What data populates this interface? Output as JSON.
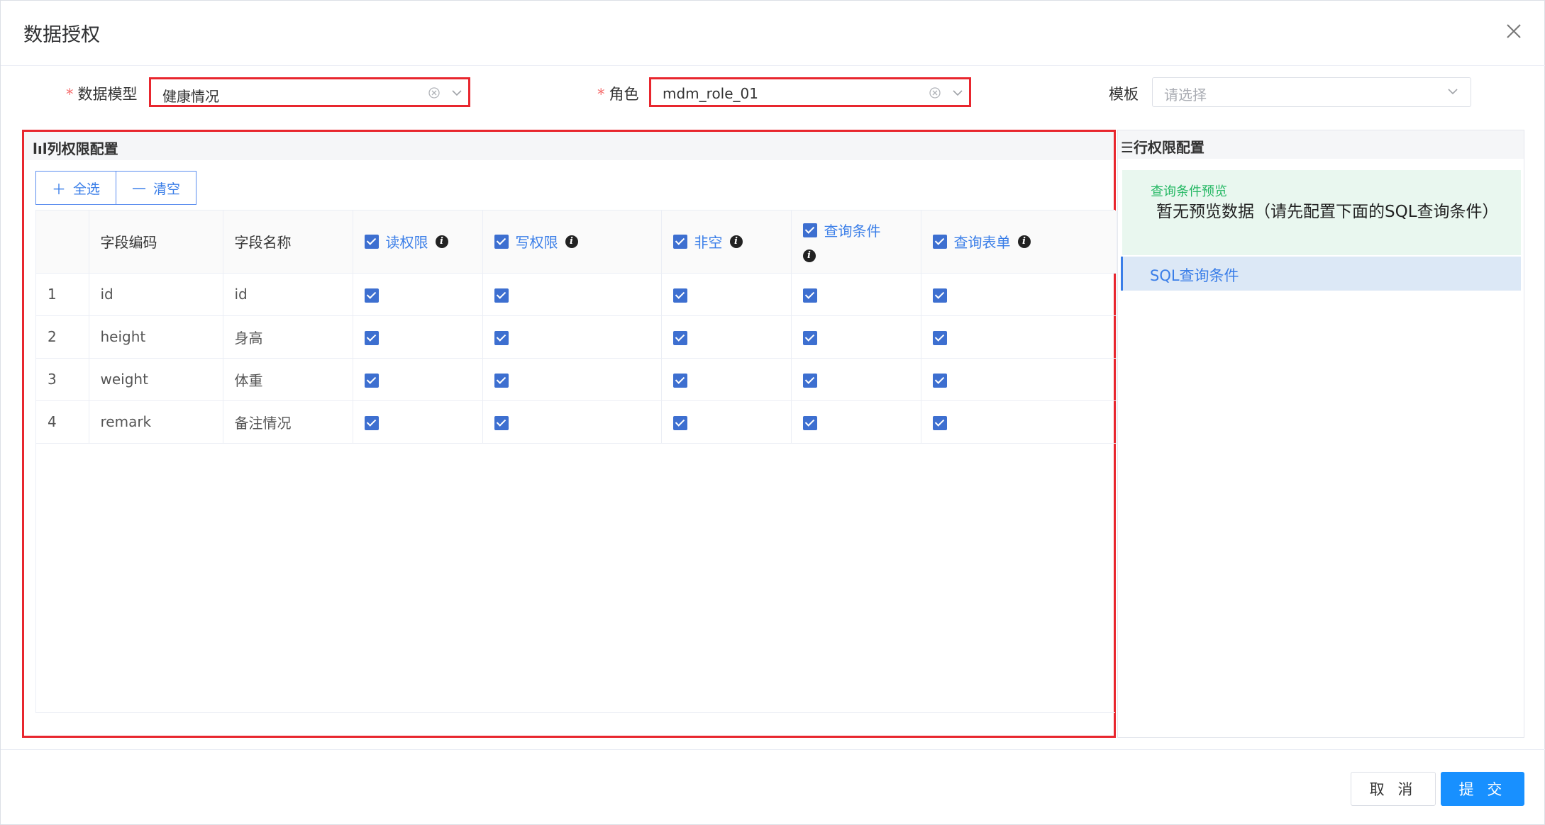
{
  "dialog": {
    "title": "数据授权"
  },
  "form": {
    "model": {
      "label": "数据模型",
      "value": "健康情况"
    },
    "role": {
      "label": "角色",
      "value": "mdm_role_01"
    },
    "template": {
      "label": "模板",
      "placeholder": "请选择"
    }
  },
  "column_panel": {
    "title": "列权限配置",
    "select_all": "全选",
    "clear": "清空",
    "headers": {
      "code": "字段编码",
      "name": "字段名称",
      "read": "读权限",
      "write": "写权限",
      "nonnull": "非空",
      "query_cond": "查询条件",
      "query_form": "查询表单"
    },
    "rows": [
      {
        "index": "1",
        "code": "id",
        "name": "id"
      },
      {
        "index": "2",
        "code": "height",
        "name": "身高"
      },
      {
        "index": "3",
        "code": "weight",
        "name": "体重"
      },
      {
        "index": "4",
        "code": "remark",
        "name": "备注情况"
      }
    ]
  },
  "row_panel": {
    "title": "行权限配置",
    "preview_label": "查询条件预览",
    "preview_text": "暂无预览数据（请先配置下面的SQL查询条件）",
    "sql_tab": "SQL查询条件"
  },
  "footer": {
    "cancel": "取 消",
    "submit": "提 交"
  },
  "colors": {
    "primary": "#1890ff",
    "highlight": "#e8262e",
    "checkbox": "#3d6fd0",
    "success": "#25b864"
  }
}
